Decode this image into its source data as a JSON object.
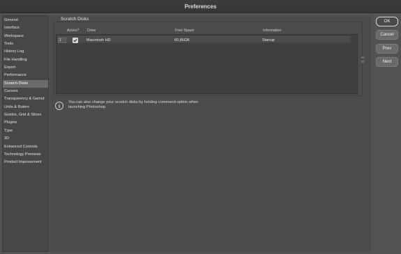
{
  "window": {
    "title": "Preferences"
  },
  "sidebar": {
    "items": [
      {
        "label": "General"
      },
      {
        "label": "Interface"
      },
      {
        "label": "Workspace"
      },
      {
        "label": "Tools"
      },
      {
        "label": "History Log"
      },
      {
        "label": "File Handling"
      },
      {
        "label": "Export"
      },
      {
        "label": "Performance"
      },
      {
        "label": "Scratch Disks"
      },
      {
        "label": "Cursors"
      },
      {
        "label": "Transparency & Gamut"
      },
      {
        "label": "Units & Rulers"
      },
      {
        "label": "Guides, Grid & Slices"
      },
      {
        "label": "Plugins"
      },
      {
        "label": "Type"
      },
      {
        "label": "3D"
      },
      {
        "label": "Enhanced Controls"
      },
      {
        "label": "Technology Previews"
      },
      {
        "label": "Product Improvement"
      }
    ],
    "selected": "Scratch Disks"
  },
  "scratch_disks": {
    "section_title": "Scratch Disks",
    "columns": {
      "active": "Active?",
      "drive": "Drive",
      "free_space": "Free Space",
      "information": "Information"
    },
    "rows": [
      {
        "index": "1",
        "active": true,
        "drive": "Macintosh HD",
        "free_space": "60,86GB",
        "information": "Startup"
      }
    ],
    "info_text_line1": "You can also change your scratch disks by holding command-option when",
    "info_text_line2": "launching Photoshop."
  },
  "buttons": {
    "ok": "OK",
    "cancel": "Cancel",
    "prev": "Prev",
    "next": "Next"
  },
  "colors": {
    "background": "#535353",
    "sidebar_selected": "#6b6b6b",
    "panel": "#4c4c4c"
  }
}
